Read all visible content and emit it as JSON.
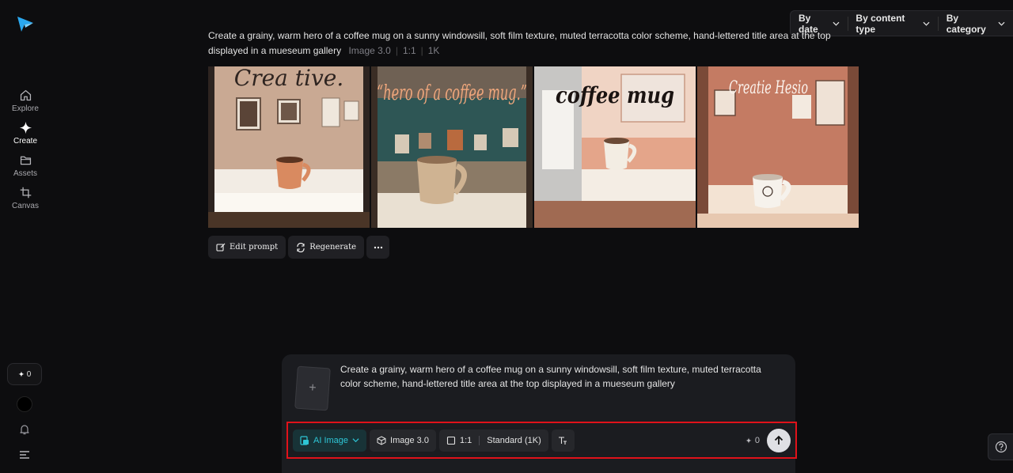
{
  "sidebar": {
    "nav": [
      {
        "label": "Explore",
        "icon": "home-icon"
      },
      {
        "label": "Create",
        "icon": "sparkle-icon"
      },
      {
        "label": "Assets",
        "icon": "folder-icon"
      },
      {
        "label": "Canvas",
        "icon": "crop-icon"
      }
    ],
    "credits": "0"
  },
  "filters": {
    "by_date": "By date",
    "by_content_type": "By content type",
    "by_category": "By category"
  },
  "result": {
    "prompt": "Create a grainy, warm hero of a coffee mug on a sunny windowsill, soft film texture, muted terracotta color scheme, hand-lettered title area at the top displayed in a mueseum gallery",
    "model": "Image 3.0",
    "ratio": "1:1",
    "resolution": "1K",
    "images": [
      {
        "lettering": "Crea tive."
      },
      {
        "lettering": "“hero of a coffee mug.”"
      },
      {
        "lettering": "coffee mug"
      },
      {
        "lettering": "Creatie Hesio"
      }
    ],
    "actions": {
      "edit": "Edit prompt",
      "regenerate": "Regenerate"
    }
  },
  "composer": {
    "text": "Create a grainy, warm hero of a coffee mug on a sunny windowsill, soft film texture, muted terracotta color scheme, hand-lettered title area at the top displayed in a mueseum gallery",
    "mode": "AI Image",
    "model": "Image 3.0",
    "ratio": "1:1",
    "quality": "Standard (1K)",
    "credits": "0"
  },
  "colors": {
    "accent": "#2ec6d6",
    "highlight": "#e0121a",
    "background": "#0d0d0f"
  }
}
